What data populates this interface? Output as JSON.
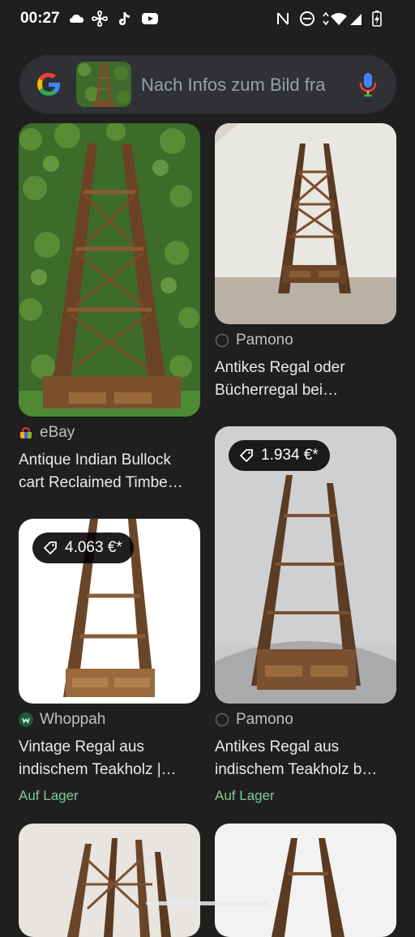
{
  "status": {
    "time": "00:27"
  },
  "search": {
    "placeholder": "Nach Infos zum Bild fra"
  },
  "results": [
    {
      "source": "eBay",
      "title_line1": "Antique Indian Bullock",
      "title_line2": "cart Reclaimed Timbe…"
    },
    {
      "source": "Pamono",
      "title_line1": "Antikes Regal oder",
      "title_line2": "Bücherregal bei…"
    },
    {
      "source": "Pamono",
      "price": "1.934 €*",
      "title_line1": "Antikes Regal aus",
      "title_line2": "indischem Teakholz b…",
      "stock": "Auf Lager"
    },
    {
      "source": "Whoppah",
      "price": "4.063 €*",
      "title_line1": "Vintage Regal aus",
      "title_line2": "indischem Teakholz |…",
      "stock": "Auf Lager"
    }
  ],
  "colors": {
    "background": "#1f1f1f",
    "stock_green": "#81c995"
  }
}
